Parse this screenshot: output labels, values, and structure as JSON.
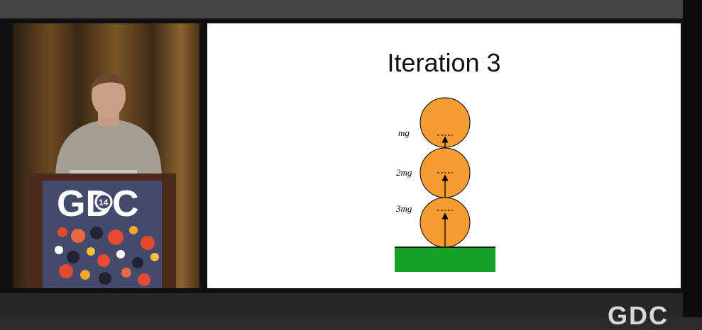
{
  "slide": {
    "title": "Iteration 3",
    "force_labels": [
      "mg",
      "2mg",
      "3mg"
    ]
  },
  "speaker_video": {
    "podium_logo": {
      "text": "GDC",
      "badge": "14"
    }
  },
  "watermark": "GDC",
  "colors": {
    "ball_fill": "#f99b33",
    "ground_fill": "#16a12b",
    "slide_background": "#ffffff",
    "podium_logo_panel": "#434a6b"
  }
}
